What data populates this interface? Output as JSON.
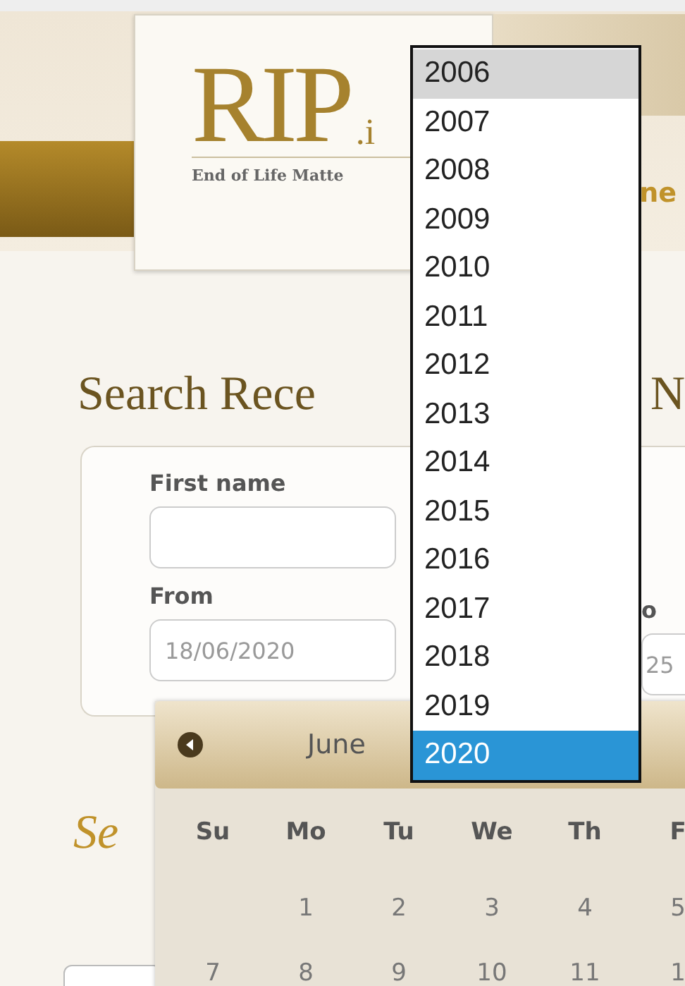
{
  "header": {
    "logo": {
      "mark": "RIP",
      "suffix": ".i",
      "tagline": "End of Life Matte"
    },
    "nav_fragment": "ne"
  },
  "search_heading": {
    "left": "Search Rece",
    "right": "N"
  },
  "form": {
    "first_name_label": "First name",
    "from_label": "From",
    "from_value": "18/06/2020",
    "to_label": "o",
    "to_value": "25"
  },
  "section_heading": "Se",
  "datepicker": {
    "month": "June",
    "weekdays": [
      "Su",
      "Mo",
      "Tu",
      "We",
      "Th",
      "F"
    ],
    "weeks": [
      {
        "days": [
          "1",
          "2",
          "3",
          "4",
          "5"
        ]
      },
      {
        "days": [
          "7",
          "8",
          "9",
          "10",
          "11",
          "1"
        ]
      }
    ]
  },
  "year_dropdown": [
    {
      "label": "2006",
      "highlighted": true,
      "selected": false
    },
    {
      "label": "2007",
      "highlighted": false,
      "selected": false
    },
    {
      "label": "2008",
      "highlighted": false,
      "selected": false
    },
    {
      "label": "2009",
      "highlighted": false,
      "selected": false
    },
    {
      "label": "2010",
      "highlighted": false,
      "selected": false
    },
    {
      "label": "2011",
      "highlighted": false,
      "selected": false
    },
    {
      "label": "2012",
      "highlighted": false,
      "selected": false
    },
    {
      "label": "2013",
      "highlighted": false,
      "selected": false
    },
    {
      "label": "2014",
      "highlighted": false,
      "selected": false
    },
    {
      "label": "2015",
      "highlighted": false,
      "selected": false
    },
    {
      "label": "2016",
      "highlighted": false,
      "selected": false
    },
    {
      "label": "2017",
      "highlighted": false,
      "selected": false
    },
    {
      "label": "2018",
      "highlighted": false,
      "selected": false
    },
    {
      "label": "2019",
      "highlighted": false,
      "selected": false
    },
    {
      "label": "2020",
      "highlighted": false,
      "selected": true
    }
  ]
}
